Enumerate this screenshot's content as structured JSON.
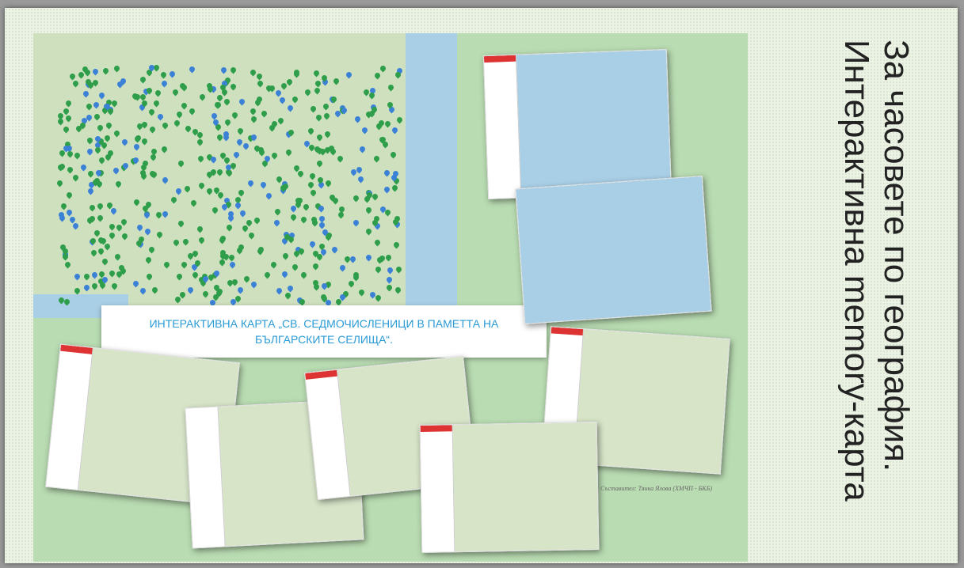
{
  "slide": {
    "title": "За часовете по география. Интерактивна memory-карта",
    "caption": "ИНТЕРАКТИВНА КАРТА „СВ. СЕДМОЧИСЛЕНИЦИ В ПАМЕТТА НА БЪЛГАРСКИТЕ СЕЛИЩА“.",
    "credit": "Съставител: Тянка Ялова (ХМЧП - БКБ)"
  },
  "colors": {
    "green_pin": "#2e9e4a",
    "blue_pin": "#3b82d6",
    "panel": "#b9dcb2",
    "caption_text": "#2a9bd6"
  }
}
